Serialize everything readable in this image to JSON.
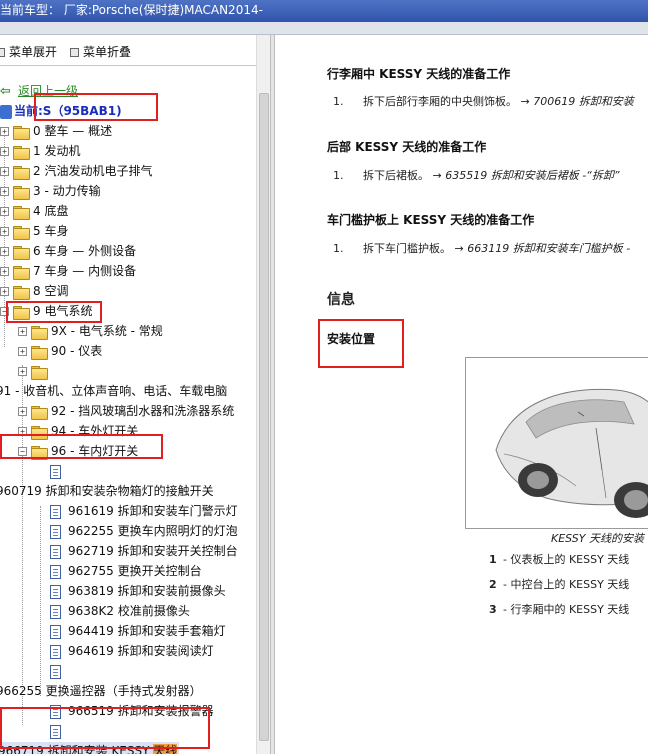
{
  "titlebar": {
    "text": "当前车型：  厂家:Porsche(保时捷)MACAN2014-"
  },
  "toolbar": {
    "expand_label": "菜单展开",
    "collapse_label": "菜单折叠"
  },
  "tree": {
    "back_label": "返回上一级",
    "current_label": "当前:S（95BAB1)",
    "items": [
      {
        "label": "0 整车 — 概述"
      },
      {
        "label": "1 发动机"
      },
      {
        "label": "2 汽油发动机电子排气"
      },
      {
        "label": "3 - 动力传输"
      },
      {
        "label": "4 底盘"
      },
      {
        "label": "5 车身"
      },
      {
        "label": "6 车身 — 外侧设备"
      },
      {
        "label": "7 车身 — 内侧设备"
      },
      {
        "label": "8 空调"
      },
      {
        "label": "9 电气系统"
      },
      {
        "label": "9X - 电气系统 - 常规"
      },
      {
        "label": "90 - 仪表"
      },
      {
        "label": ""
      },
      {
        "label": "91 - 收音机、立体声音响、电话、车载电脑"
      },
      {
        "label": "92 - 挡风玻璃刮水器和洗涤器系统"
      },
      {
        "label": "94 - 车外灯开关"
      },
      {
        "label": "96 - 车内灯开关"
      },
      {
        "label": ""
      },
      {
        "label": "960719 拆卸和安装杂物箱灯的接触开关"
      },
      {
        "label": "961619 拆卸和安装车门警示灯"
      },
      {
        "label": "962255 更换车内照明灯的灯泡"
      },
      {
        "label": "962719 拆卸和安装开关控制台"
      },
      {
        "label": "962755 更换开关控制台"
      },
      {
        "label": "963819 拆卸和安装前摄像头"
      },
      {
        "label": "9638K2 校准前摄像头"
      },
      {
        "label": "964419 拆卸和安装手套箱灯"
      },
      {
        "label": "964619 拆卸和安装阅读灯"
      },
      {
        "label": ""
      },
      {
        "label": "966255 更换遥控器（手持式发射器）"
      },
      {
        "label": "966519 拆卸和安装报警器"
      },
      {
        "label": ""
      },
      {
        "label_prefix": "966719 拆卸和安装 KESSY ",
        "label_highlight": "天线"
      }
    ]
  },
  "content": {
    "sections": [
      {
        "heading": "行李厢中 KESSY 天线的准备工作",
        "num": "1.",
        "text": "拆下后部行李厢的中央侧饰板。 → ",
        "ref": "700619 拆卸和安装"
      },
      {
        "heading": "后部 KESSY 天线的准备工作",
        "num": "1.",
        "text": "拆下后裙板。 → ",
        "ref": "635519 拆卸和安装后裙板 -“拆卸”"
      },
      {
        "heading": "车门槛护板上 KESSY 天线的准备工作",
        "num": "1.",
        "text": "拆下车门槛护板。 → ",
        "ref": "663119 拆卸和安装车门槛护板 -"
      }
    ],
    "info_heading": "信息",
    "install_heading": "安装位置",
    "figure_caption": "KESSY 天线的安装",
    "legend": [
      {
        "num": "1",
        "text": "- 仪表板上的 KESSY 天线"
      },
      {
        "num": "2",
        "text": "- 中控台上的 KESSY 天线"
      },
      {
        "num": "3",
        "text": "- 行李厢中的 KESSY 天线"
      }
    ]
  }
}
